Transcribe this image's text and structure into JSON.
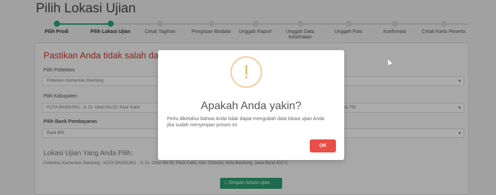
{
  "page": {
    "title": "Pilih Lokasi Ujian"
  },
  "stepper": {
    "steps": [
      {
        "label": "Pilih Prodi",
        "state": "done"
      },
      {
        "label": "Pilih Lokasi Ujian",
        "state": "done"
      },
      {
        "label": "Cetak Tagihan",
        "state": "pending"
      },
      {
        "label": "Pengisian Biodata",
        "state": "pending"
      },
      {
        "label": "Unggah Raport",
        "state": "pending"
      },
      {
        "label": "Unggah Data Kesehatan",
        "state": "pending"
      },
      {
        "label": "Unggah Foto",
        "state": "pending"
      },
      {
        "label": "Konfirmasi",
        "state": "pending"
      },
      {
        "label": "Cetak Kartu Peserta",
        "state": "pending"
      }
    ],
    "done_color": "#24a37a"
  },
  "form": {
    "heading": "Pastikan Anda tidak salah dalam",
    "poltekkes_label": "Pilih Poltekkes",
    "poltekkes_value": "Poltekkes Kemenkes Bandung",
    "kabupaten_label": "Pilih Kabupaten",
    "kabupaten_value": "KOTA BANDUNG - Jl. Dr. Otten No.32, Pasir Kaliki",
    "kabupaten_extra": "Kota 750",
    "bank_label": "Pilih Bank Pembayaran",
    "bank_value": "Bank BNI",
    "lokasi_title": "Lokasi Ujian Yang Anda Pilih:",
    "lokasi_value": "Poltekkes Kemenkes Bandung - KOTA BANDUNG - Jl. Dr. Otten No.32, Pasir Kaliki, Kec. Cicendo, Kota Bandung, Jawa Barat 40171",
    "save_label": "Simpan lokasi ujian"
  },
  "modal": {
    "icon": "exclamation-icon",
    "icon_glyph": "!",
    "title": "Apakah Anda yakin?",
    "text": "Perlu diketahui bahwa Anda tidak dapat mengubah data lokasi ujian Anda jika sudah menyimpan proses ini",
    "ok_label": "OK",
    "ok_color": "#e94e47",
    "warn_color": "#f4b064"
  }
}
